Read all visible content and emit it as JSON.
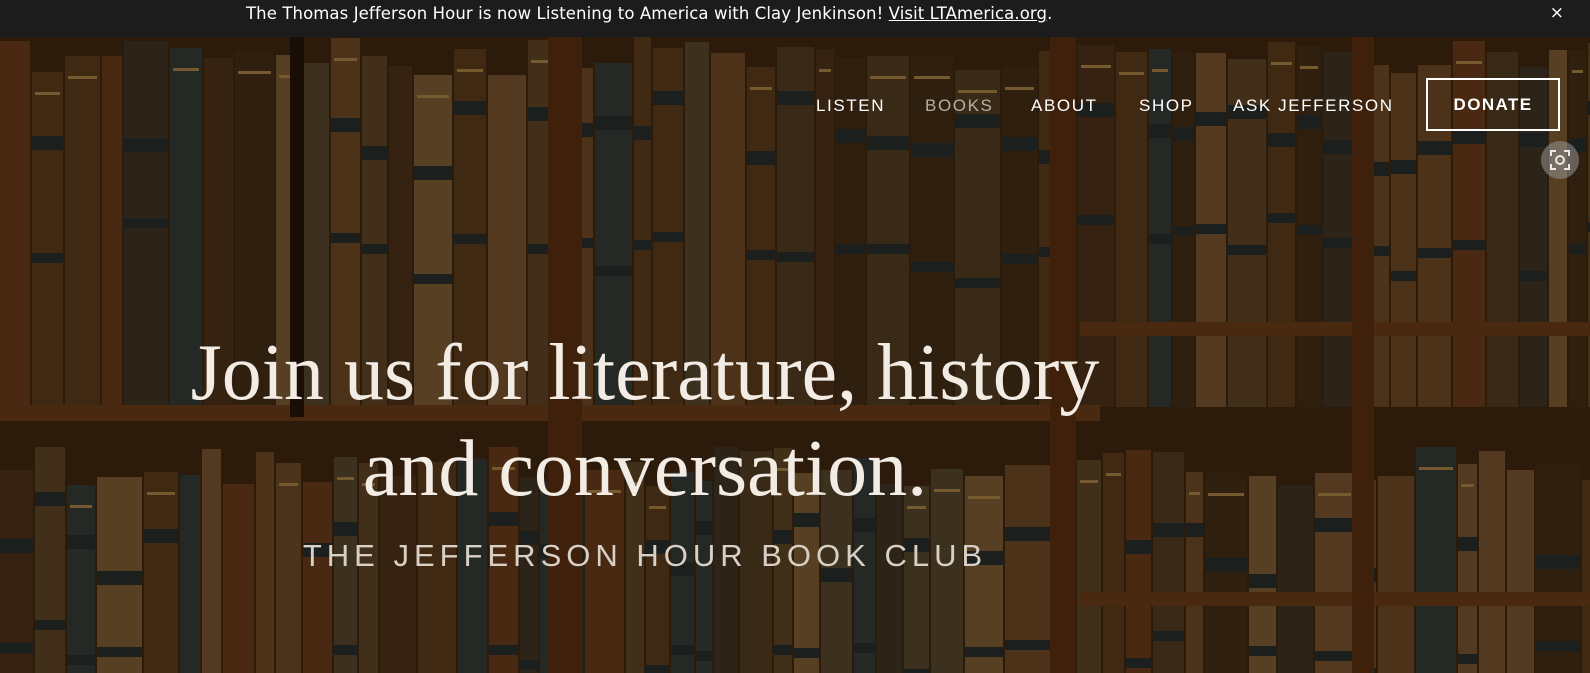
{
  "announcement": {
    "text": "The Thomas Jefferson Hour is now Listening to America with Clay Jenkinson!",
    "link_text": "Visit LTAmerica.org",
    "trailing": ".",
    "close_symbol": "×"
  },
  "nav": {
    "items": [
      {
        "label": "LISTEN"
      },
      {
        "label": "BOOKS"
      },
      {
        "label": "ABOUT"
      },
      {
        "label": "SHOP"
      },
      {
        "label": "ASK JEFFERSON"
      }
    ],
    "donate_label": "DONATE"
  },
  "hero": {
    "headline_line1": "Join us for literature, history",
    "headline_line2": "and conversation.",
    "subheadline": "THE JEFFERSON HOUR BOOK CLUB"
  },
  "colors": {
    "announcement_bg": "#1c1c1c",
    "nav_text": "#ffffff",
    "nav_active_text": "#b9aea2",
    "headline_text": "#f2ece4"
  },
  "icons": {
    "close": "close-icon",
    "lens": "image-search-icon"
  }
}
